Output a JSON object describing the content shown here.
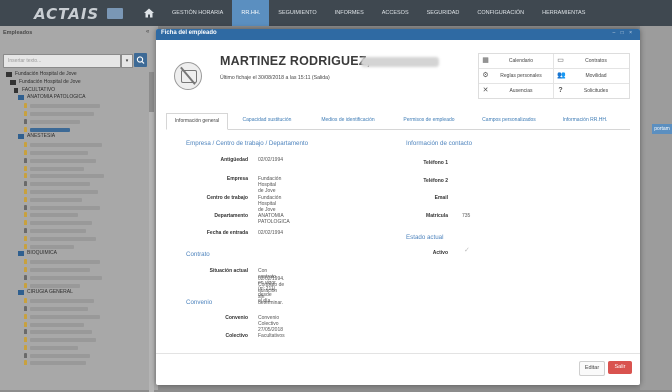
{
  "app": {
    "logo_text": "ACTAIS"
  },
  "nav": {
    "items": [
      "GESTIÓN HORARIA",
      "RR.HH.",
      "SEGUIMIENTO",
      "INFORMES",
      "ACCESOS",
      "SEGURIDAD",
      "CONFIGURACIÓN",
      "HERRAMIENTAS"
    ],
    "active": "RR.HH."
  },
  "sidebar": {
    "title": "Empleados",
    "search_placeholder": "Insertar texto...",
    "tree": {
      "root": "Fundación Hospital de Jove",
      "child": "Fundación Hospital de Jove",
      "group": "FACULTATIVO",
      "departments": [
        "ANATOMIA PATOLOGICA",
        "ANESTESIA",
        "BIOQUIMICA",
        "CIRUGIA GENERAL"
      ]
    }
  },
  "right_strip": {
    "button_label": "portam"
  },
  "modal": {
    "title": "Ficha del empleado",
    "controls": "– □ ×",
    "employee_name": "MARTINEZ RODRIGUEZ,",
    "last_check": "Último fichaje el 30/08/2018 a las 15:11 (Salida)",
    "quick_actions": [
      {
        "icon": "calendar-icon",
        "label": "Calendario"
      },
      {
        "icon": "contracts-icon",
        "label": "Contratos"
      },
      {
        "icon": "rules-icon",
        "label": "Reglas personales"
      },
      {
        "icon": "mobility-icon",
        "label": "Movilidad"
      },
      {
        "icon": "absence-icon",
        "label": "Ausencias"
      },
      {
        "icon": "help-icon",
        "label": "Solicitudes"
      }
    ],
    "tabs": [
      "Información general",
      "Capacidad sustitución",
      "Medios de identificación",
      "Permisos de empleado",
      "Campos personalizados",
      "Información RR.HH."
    ],
    "active_tab": "Información general",
    "sections": {
      "company": {
        "title": "Empresa / Centro de trabajo / Departamento",
        "fields": [
          {
            "label": "Antigüedad",
            "value": "02/02/1994"
          },
          {
            "label": "Empresa",
            "value": "Fundación Hospital de Jove"
          },
          {
            "label": "Centro de trabajo",
            "value": "Fundación Hospital de Jove"
          },
          {
            "label": "Departamento",
            "value": "ANATOMIA PATOLOGICA"
          },
          {
            "label": "Fecha de entrada",
            "value": "02/02/1994"
          }
        ]
      },
      "contract": {
        "title": "Contrato",
        "label": "Situación actual",
        "value_line1": "Con contrato en vigor (nº 211) desde el día",
        "value_line2": "02/02/1994. Contrato de duración sin determinar."
      },
      "agreement": {
        "title": "Convenio",
        "fields": [
          {
            "label": "Convenio",
            "value": "Convenio Colectivo 27/05/2018"
          },
          {
            "label": "Colectivo",
            "value": "Facultativos"
          }
        ]
      },
      "contact": {
        "title": "Información de contacto",
        "fields": [
          {
            "label": "Teléfono 1",
            "value": ""
          },
          {
            "label": "Teléfono 2",
            "value": ""
          },
          {
            "label": "Email",
            "value": ""
          },
          {
            "label": "Matrícula",
            "value": "735"
          }
        ]
      },
      "status": {
        "title": "Estado actual",
        "label": "Activo"
      }
    },
    "buttons": {
      "edit": "Editar",
      "exit": "Salir"
    }
  },
  "colors": {
    "topbar": "#3f4850",
    "accent": "#2f6aa3",
    "exit_button": "#d9534f",
    "section_title": "#4d83bd"
  }
}
